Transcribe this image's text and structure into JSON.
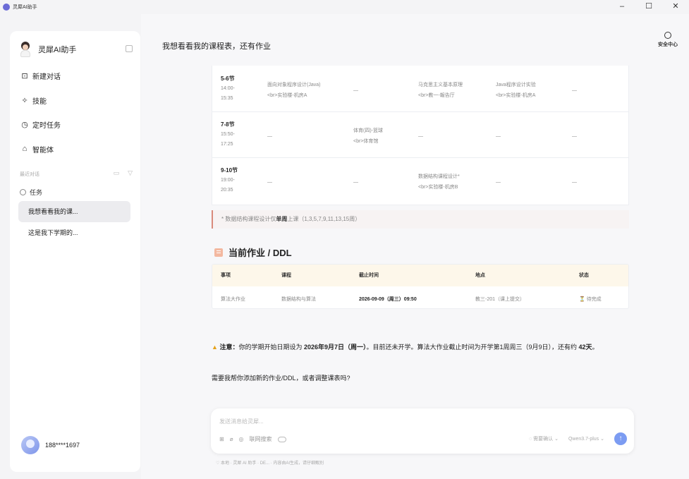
{
  "window": {
    "title": "灵犀AI助手",
    "controls": {
      "minimize": "–",
      "maximize": "☐",
      "close": "✕"
    }
  },
  "sidebar": {
    "app_name": "灵犀AI助手",
    "menu": [
      {
        "label": "新建对话",
        "icon": "new-chat-icon",
        "glyph": "⊡"
      },
      {
        "label": "技能",
        "icon": "skill-icon",
        "glyph": "✧"
      },
      {
        "label": "定时任务",
        "icon": "clock-icon",
        "glyph": "◷"
      },
      {
        "label": "智能体",
        "icon": "agent-icon",
        "glyph": "⌂"
      }
    ],
    "recent_label": "最近对话",
    "task_label": "任务",
    "conversations": [
      {
        "label": "我想看看我的课...",
        "active": true
      },
      {
        "label": "这是我下学期的...",
        "active": false
      }
    ],
    "user_name": "188****1697"
  },
  "main": {
    "query": "我想看看我的课程表，还有作业",
    "security_label": "安全中心",
    "schedule_rows": [
      {
        "period": "5-6节",
        "time_start": "14:00-",
        "time_end": "15:35",
        "cells": [
          [
            "面向对象程序设计(Java)",
            "<br>实验楼-机房A"
          ],
          [
            "—"
          ],
          [
            "马克思主义基本原理",
            "<br>教一-報告厅"
          ],
          [
            "Java程序设计实验",
            "<br>实验楼-机房A"
          ],
          [
            "—"
          ]
        ]
      },
      {
        "period": "7-8节",
        "time_start": "15:50-",
        "time_end": "17:25",
        "cells": [
          [
            "—"
          ],
          [
            "体育(四)-篮球",
            "<br>体育馆"
          ],
          [
            "—"
          ],
          [
            "—"
          ],
          [
            "—"
          ]
        ]
      },
      {
        "period": "9-10节",
        "time_start": "19:00-",
        "time_end": "20:35",
        "cells": [
          [
            "—"
          ],
          [
            "—"
          ],
          [
            "数据结构课程设计*",
            "<br>实验楼-机房B"
          ],
          [
            "—"
          ],
          [
            "—"
          ]
        ]
      }
    ],
    "note_prefix": "* 数据结构课程设计仅",
    "note_bold": "单周",
    "note_suffix": "上课（1,3,5,7,9,11,13,15周）",
    "hw_title": "当前作业 / DDL",
    "hw_headers": [
      "事项",
      "课程",
      "截止时间",
      "地点",
      "状态"
    ],
    "hw_row": {
      "item": "算法大作业",
      "course": "数据结构与算法",
      "deadline": "2026-09-09（周三）09:50",
      "location": "教三-201（课上提交）",
      "status": "⏳ 待完成"
    },
    "warn_label": "注意：",
    "warn_text_1": "你的学期开始日期设为 ",
    "warn_date": "2026年9月7日（周一）",
    "warn_text_2": "。目前还未开学。算法大作业截止时间为开学第1周周三（9月9日），还有约 ",
    "warn_days": "42天",
    "warn_text_3": "。",
    "question": "需要我帮你添加新的作业/DDL，或者调整课表吗?"
  },
  "input": {
    "placeholder": "发送消息给灵犀...",
    "web_search_label": "联网搜索",
    "confirm_label": "需要确认",
    "model_label": "Qwen3.7-plus",
    "footer_note": "♡ 本地 · 灵犀 AI 助手 · DE... · 内容由AI生成，请仔细甄别"
  },
  "colors": {
    "accent": "#7c9cf2",
    "warning": "#e5a21b",
    "note_border": "#d98b7c",
    "table_header_bg": "#fdf7ea"
  }
}
